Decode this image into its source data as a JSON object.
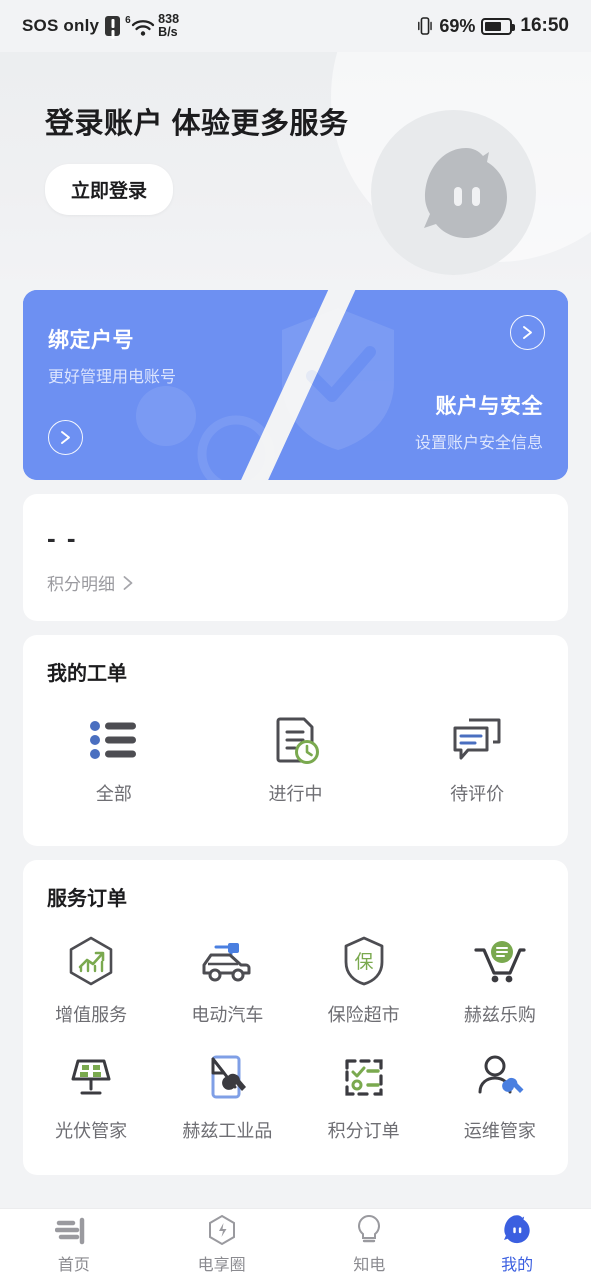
{
  "status_bar": {
    "carrier": "SOS only",
    "warning_icon": "warning-icon",
    "wifi_gen": "6",
    "net_speed_value": "838",
    "net_speed_unit": "B/s",
    "vibrate_icon": "vibrate-icon",
    "battery_percent": "69%",
    "battery_icon": "battery-icon",
    "time": "16:50"
  },
  "hero": {
    "title": "登录账户 体验更多服务",
    "login_button": "立即登录",
    "avatar_icon": "mascot-avatar-icon"
  },
  "blue_card": {
    "left": {
      "title": "绑定户号",
      "subtitle": "更好管理用电账号",
      "arrow_icon": "chevron-right-circle-icon"
    },
    "right": {
      "title": "账户与安全",
      "subtitle": "设置账户安全信息",
      "arrow_icon": "chevron-right-circle-icon"
    }
  },
  "points": {
    "value": "- -",
    "detail_label": "积分明细",
    "chevron_icon": "chevron-right-icon"
  },
  "work_orders": {
    "title": "我的工单",
    "items": [
      {
        "label": "全部",
        "icon": "list-icon"
      },
      {
        "label": "进行中",
        "icon": "document-clock-icon"
      },
      {
        "label": "待评价",
        "icon": "chat-bubbles-icon"
      }
    ]
  },
  "service_orders": {
    "title": "服务订单",
    "items": [
      {
        "label": "增值服务",
        "icon": "hexagon-chart-icon"
      },
      {
        "label": "电动汽车",
        "icon": "electric-car-icon"
      },
      {
        "label": "保险超市",
        "icon": "shield-insurance-icon"
      },
      {
        "label": "赫兹乐购",
        "icon": "shopping-cart-icon"
      },
      {
        "label": "光伏管家",
        "icon": "solar-panel-icon"
      },
      {
        "label": "赫兹工业品",
        "icon": "wrench-tag-icon"
      },
      {
        "label": "积分订单",
        "icon": "checklist-icon"
      },
      {
        "label": "运维管家",
        "icon": "person-wrench-icon"
      }
    ]
  },
  "tabbar": {
    "items": [
      {
        "label": "首页",
        "icon": "home-bars-icon",
        "active": false
      },
      {
        "label": "电享圈",
        "icon": "hexagon-bolt-icon",
        "active": false
      },
      {
        "label": "知电",
        "icon": "lightbulb-icon",
        "active": false
      },
      {
        "label": "我的",
        "icon": "mascot-icon",
        "active": true
      }
    ]
  },
  "colors": {
    "accent_blue": "#3b5fe0",
    "card_blue": "#6d90f2",
    "green": "#7aa94f",
    "icon_dark": "#4a4a4f",
    "text_gray": "#6e6e73",
    "page_bg": "#f2f3f5"
  }
}
